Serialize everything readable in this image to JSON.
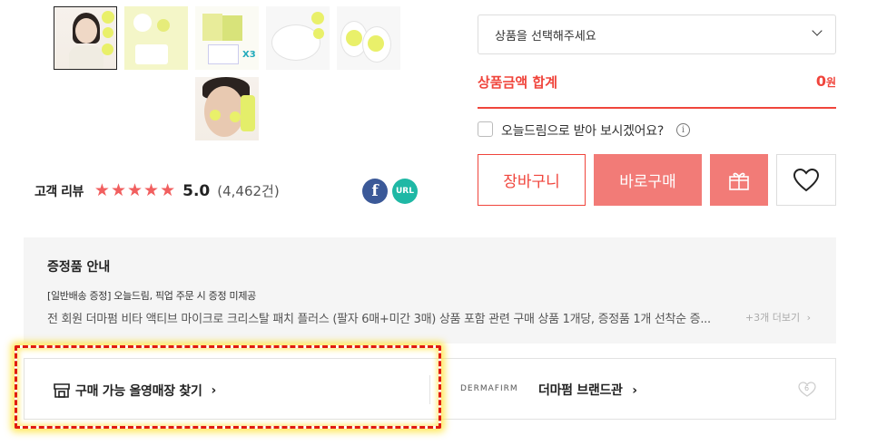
{
  "thumbnails": [
    {
      "name": "model-face",
      "selected": true
    },
    {
      "name": "patch-yellow",
      "selected": false
    },
    {
      "name": "patch-pack",
      "selected": false
    },
    {
      "name": "patch-clear",
      "selected": false
    },
    {
      "name": "patch-stickers",
      "selected": false
    },
    {
      "name": "model-patches",
      "selected": false
    }
  ],
  "review": {
    "label": "고객 리뷰",
    "stars": 5,
    "score": "5.0",
    "count": "(4,462건)",
    "star_color": "#f15f5f"
  },
  "share": {
    "facebook_glyph": "f",
    "url_label": "URL",
    "facebook_color": "#3b5998",
    "url_color": "#1fb8a5"
  },
  "product_select": {
    "placeholder": "상품을 선택해주세요"
  },
  "total": {
    "label": "상품금액 합계",
    "value": "0",
    "unit": "원",
    "color": "#f0453c"
  },
  "today_dream": {
    "label": "오늘드림으로 받아 보시겠어요?",
    "checked": false
  },
  "buttons": {
    "cart": "장바구니",
    "buy": "바로구매",
    "gift_icon": "gift-icon",
    "wish_icon": "heart-icon"
  },
  "gift": {
    "title": "증정품 안내",
    "tag": "[일반배송 증정] 오늘드림, 픽업 주문 시 증정 미제공",
    "desc": "전 회원 더마펌 비타 액티브 마이크로 크리스탈 패치 플러스 (팔자 6매+미간 3매) 상품 포함 관련 구매 상품 1개당, 증정품 1개 선착순 증...",
    "more": "+3개 더보기"
  },
  "store": {
    "label": "구매 가능 올영매장 찾기",
    "arrow": "›"
  },
  "brand": {
    "logo": "DERMAFIRM",
    "label": "더마펌 브랜드관",
    "arrow": "›",
    "like_count": "6"
  }
}
